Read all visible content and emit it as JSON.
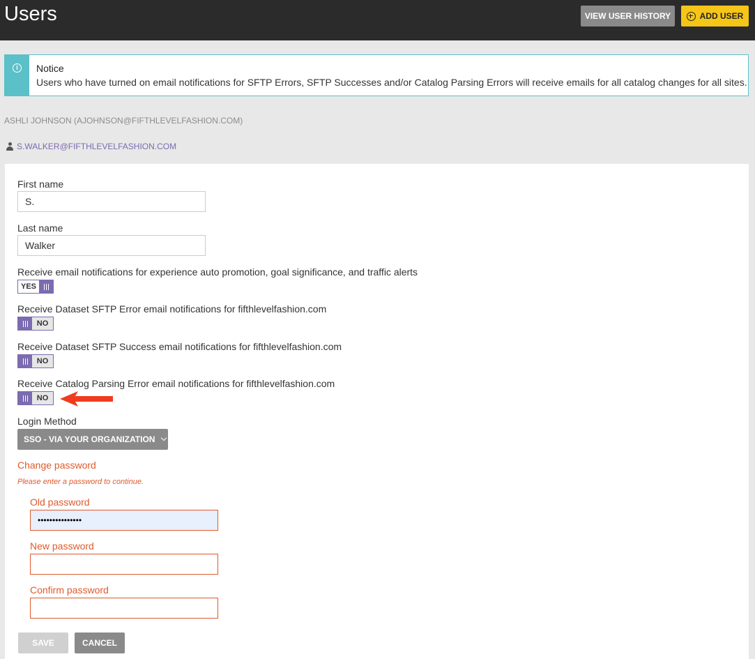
{
  "header": {
    "title": "Users",
    "view_history_label": "VIEW USER HISTORY",
    "add_user_label": "ADD USER"
  },
  "notice": {
    "icon": "info-icon",
    "title": "Notice",
    "text": "Users who have turned on email notifications for SFTP Errors, SFTP Successes and/or Catalog Parsing Errors will receive emails for all catalog changes for all sites."
  },
  "account": {
    "owner": "ASHLI JOHNSON (AJOHNSON@FIFTHLEVELFASHION.COM)",
    "user_email": "S.WALKER@FIFTHLEVELFASHION.COM"
  },
  "form": {
    "first_name": {
      "label": "First name",
      "value": "S."
    },
    "last_name": {
      "label": "Last name",
      "value": "Walker"
    },
    "toggles": [
      {
        "label": "Receive email notifications for experience auto promotion, goal significance, and traffic alerts",
        "state": "YES"
      },
      {
        "label": "Receive Dataset SFTP Error email notifications for fifthlevelfashion.com",
        "state": "NO"
      },
      {
        "label": "Receive Dataset SFTP Success email notifications for fifthlevelfashion.com",
        "state": "NO"
      },
      {
        "label": "Receive Catalog Parsing Error email notifications for fifthlevelfashion.com",
        "state": "NO"
      }
    ],
    "login_method": {
      "label": "Login Method",
      "value": "SSO - VIA YOUR ORGANIZATION"
    },
    "change_password": {
      "title": "Change password",
      "warning": "Please enter a password to continue.",
      "old_label": "Old password",
      "old_value": "•••••••••••••••",
      "new_label": "New password",
      "confirm_label": "Confirm password"
    },
    "save_label": "SAVE",
    "cancel_label": "CANCEL"
  },
  "colors": {
    "accent": "#7b6bb0",
    "notice": "#5bc0c8",
    "error": "#e05a2b",
    "primary_button": "#f5c518",
    "annotation_arrow": "#f03c1e"
  }
}
